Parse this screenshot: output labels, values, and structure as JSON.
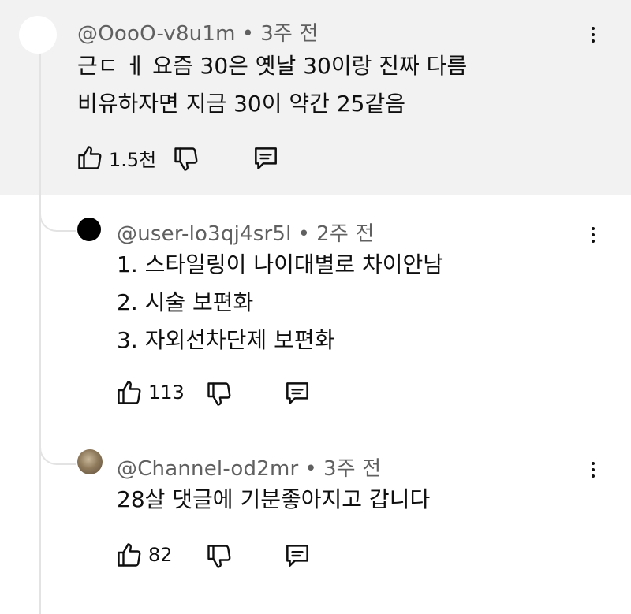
{
  "comments": [
    {
      "handle": "@OooO-v8u1m",
      "time": "3주 전",
      "lines": [
        "근ㄷ ㅔ 요즘 30은 옛날 30이랑 진짜 다름",
        "비유하자면 지금 30이 약간 25같음"
      ],
      "likes": "1.5천"
    },
    {
      "handle": "@user-lo3qj4sr5l",
      "time": "2주 전",
      "lines": [
        "1. 스타일링이 나이대별로 차이안남",
        "2. 시술 보편화",
        "3. 자외선차단제 보편화"
      ],
      "likes": "113"
    },
    {
      "handle": "@Channel-od2mr",
      "time": "3주 전",
      "lines": [
        "28살 댓글에 기분좋아지고 갑니다"
      ],
      "likes": "82"
    }
  ],
  "separator": "•",
  "icons": {
    "like": "thumbs-up-icon",
    "dislike": "thumbs-down-icon",
    "reply": "reply-icon",
    "menu": "more-vert-icon"
  }
}
